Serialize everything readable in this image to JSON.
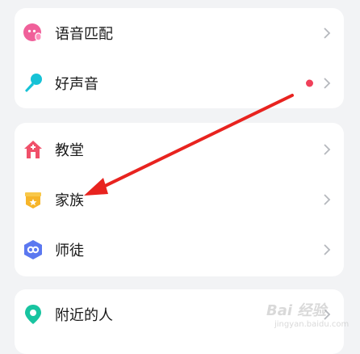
{
  "group1": {
    "items": [
      {
        "label": "语音匹配",
        "icon": "voice-match-icon",
        "color": "#f0609a"
      },
      {
        "label": "好声音",
        "icon": "microphone-icon",
        "color": "#16c2d6",
        "has_dot": true
      }
    ]
  },
  "group2": {
    "items": [
      {
        "label": "教堂",
        "icon": "church-icon",
        "color": "#f0506a"
      },
      {
        "label": "家族",
        "icon": "family-badge-icon",
        "color": "#f6b52a"
      },
      {
        "label": "师徒",
        "icon": "mentor-icon",
        "color": "#5b78f0"
      }
    ]
  },
  "group3": {
    "items": [
      {
        "label": "附近的人",
        "icon": "location-pin-icon",
        "color": "#18c4a0"
      }
    ]
  },
  "watermark": {
    "text": "Bai 经验",
    "url": "jingyan.baidu.com"
  },
  "annotation": {
    "arrow_color": "#e8231f"
  }
}
